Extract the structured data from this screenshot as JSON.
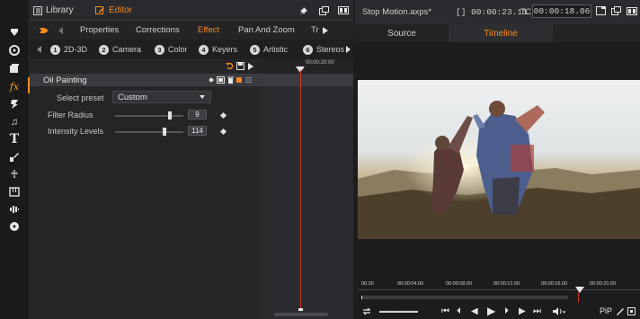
{
  "colors": {
    "accent_orange": "#f58a1f",
    "playhead_red": "#c23a2a",
    "panel_bg": "#252528"
  },
  "left_toolbar": {
    "icons": [
      "main-menu-icon",
      "color-wheel-icon",
      "library-stack-icon",
      "fx-icon",
      "transition-icon",
      "music-note-icon",
      "text-title-icon",
      "paint-brush-icon",
      "montage-icon",
      "grid-layout-icon",
      "audio-wave-icon",
      "disc-icon"
    ]
  },
  "left_top": {
    "library_label": "Library",
    "editor_label": "Editor"
  },
  "categories": {
    "items": [
      "Properties",
      "Corrections",
      "Effect",
      "Pan And Zoom",
      "Tr"
    ],
    "active": "Effect"
  },
  "subcategories": [
    {
      "num": "1",
      "label": "2D-3D"
    },
    {
      "num": "2",
      "label": "Camera"
    },
    {
      "num": "3",
      "label": "Color"
    },
    {
      "num": "4",
      "label": "Keyers"
    },
    {
      "num": "5",
      "label": "Artistic"
    },
    {
      "num": "6",
      "label": "Stereos"
    }
  ],
  "timeline_strip": {
    "time": "00:00:20:00"
  },
  "effect": {
    "name": "Oil Painting",
    "preset_label": "Select preset",
    "preset_value": "Custom",
    "params": [
      {
        "label": "Filter Radius",
        "value": "9",
        "fraction": 0.8
      },
      {
        "label": "Intensity Levels",
        "value": "114",
        "fraction": 0.72
      }
    ]
  },
  "right_top": {
    "project": "Stop Motion.axps*",
    "duration": "[] 00:00:23.11",
    "tc_label": "TC",
    "tc_value": "00:00:18.06"
  },
  "right_tabs": {
    "source": "Source",
    "timeline": "Timeline",
    "active": "Timeline"
  },
  "ruler": {
    "labels": [
      "00.00",
      "00:00:04.00",
      "00:00:08.00",
      "00:00:12.00",
      "00:00:16.00",
      "00:00:20.00"
    ]
  },
  "controls": {
    "pip_label": "PiP"
  }
}
